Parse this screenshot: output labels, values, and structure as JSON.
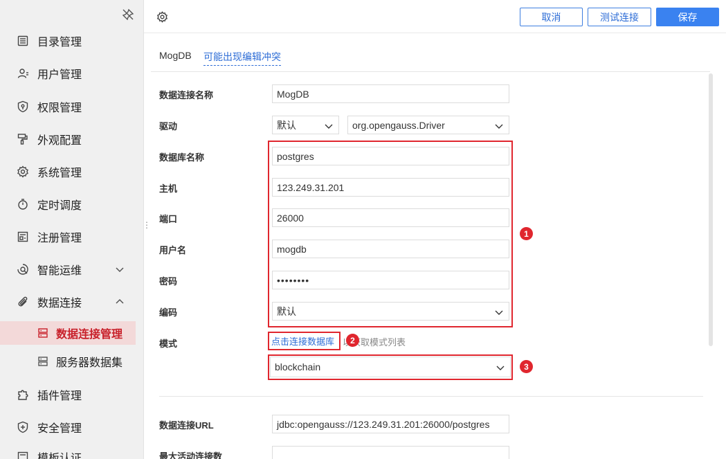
{
  "sidebar": {
    "items": [
      {
        "label": "目录管理",
        "icon": "list-icon"
      },
      {
        "label": "用户管理",
        "icon": "user-icon"
      },
      {
        "label": "权限管理",
        "icon": "shield-key-icon"
      },
      {
        "label": "外观配置",
        "icon": "paint-roller-icon"
      },
      {
        "label": "系统管理",
        "icon": "gear-icon"
      },
      {
        "label": "定时调度",
        "icon": "stopwatch-icon"
      },
      {
        "label": "注册管理",
        "icon": "register-icon"
      },
      {
        "label": "智能运维",
        "icon": "ops-icon"
      },
      {
        "label": "数据连接",
        "icon": "paperclip-icon"
      }
    ],
    "sub_items": [
      {
        "label": "数据连接管理",
        "icon": "server-icon",
        "active": true
      },
      {
        "label": "服务器数据集",
        "icon": "server-icon",
        "active": false
      }
    ],
    "items_after": [
      {
        "label": "插件管理",
        "icon": "puzzle-icon"
      },
      {
        "label": "安全管理",
        "icon": "shield-plus-icon"
      },
      {
        "label": "模板认证",
        "icon": "template-icon"
      }
    ]
  },
  "toolbar": {
    "cancel_label": "取消",
    "test_label": "测试连接",
    "save_label": "保存"
  },
  "tabs": {
    "db_name": "MogDB",
    "conflict_notice": "可能出现编辑冲突"
  },
  "form": {
    "conn_name_label": "数据连接名称",
    "conn_name_value": "MogDB",
    "driver_label": "驱动",
    "driver_mode": "默认",
    "driver_class": "org.opengauss.Driver",
    "db_name_label": "数据库名称",
    "db_name_value": "postgres",
    "host_label": "主机",
    "host_value": "123.249.31.201",
    "port_label": "端口",
    "port_value": "26000",
    "user_label": "用户名",
    "user_value": "mogdb",
    "password_label": "密码",
    "password_value": "••••••••",
    "encoding_label": "编码",
    "encoding_value": "默认",
    "schema_label": "模式",
    "schema_link": "点击连接数据库",
    "schema_hint": "以获取模式列表",
    "schema_value": "blockchain",
    "url_label": "数据连接URL",
    "url_value": "jdbc:opengauss://123.249.31.201:26000/postgres",
    "next_label": "最大活动连接数"
  },
  "annotations": [
    "1",
    "2",
    "3"
  ],
  "colors": {
    "accent": "#3a82f0",
    "annotation_red": "#e0262e",
    "active_bg": "#f3d9d9",
    "active_text": "#c8202a"
  }
}
